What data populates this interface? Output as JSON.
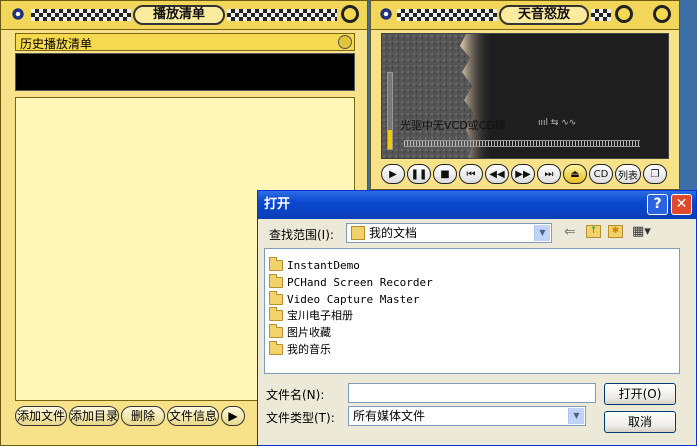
{
  "playlist": {
    "title": "播放清单",
    "history_label": "历史播放清单",
    "buttons": [
      "添加文件",
      "添加目录",
      "删除",
      "文件信息",
      "▶"
    ]
  },
  "player": {
    "title": "天音怒放",
    "status_text": "光驱中无VCD或CD碟",
    "controls": [
      {
        "name": "play",
        "glyph": "▶"
      },
      {
        "name": "pause",
        "glyph": "❚❚"
      },
      {
        "name": "stop",
        "glyph": "■"
      },
      {
        "name": "first",
        "glyph": "⏮"
      },
      {
        "name": "rewind",
        "glyph": "◀◀"
      },
      {
        "name": "forward",
        "glyph": "▶▶"
      },
      {
        "name": "last",
        "glyph": "⏭"
      },
      {
        "name": "eject",
        "glyph": "⏏"
      },
      {
        "name": "cd",
        "glyph": "CD"
      },
      {
        "name": "list",
        "glyph": "列表"
      },
      {
        "name": "mini",
        "glyph": "❐"
      }
    ],
    "volume_level": 0.25
  },
  "dialog": {
    "title": "打开",
    "lookin_label": "查找范围(I):",
    "lookin_value": "我的文档",
    "files": [
      {
        "name": "InstantDemo",
        "icon": "folder-icon"
      },
      {
        "name": "PCHand Screen Recorder",
        "icon": "folder-icon"
      },
      {
        "name": "Video Capture Master",
        "icon": "folder-icon"
      },
      {
        "name": "宝川电子相册",
        "icon": "folder-icon"
      },
      {
        "name": "图片收藏",
        "icon": "pictures-folder-icon"
      },
      {
        "name": "我的音乐",
        "icon": "music-folder-icon"
      }
    ],
    "filename_label": "文件名(N):",
    "filename_value": "",
    "filetype_label": "文件类型(T):",
    "filetype_value": "所有媒体文件",
    "open_button": "打开(O)",
    "cancel_button": "取消"
  }
}
